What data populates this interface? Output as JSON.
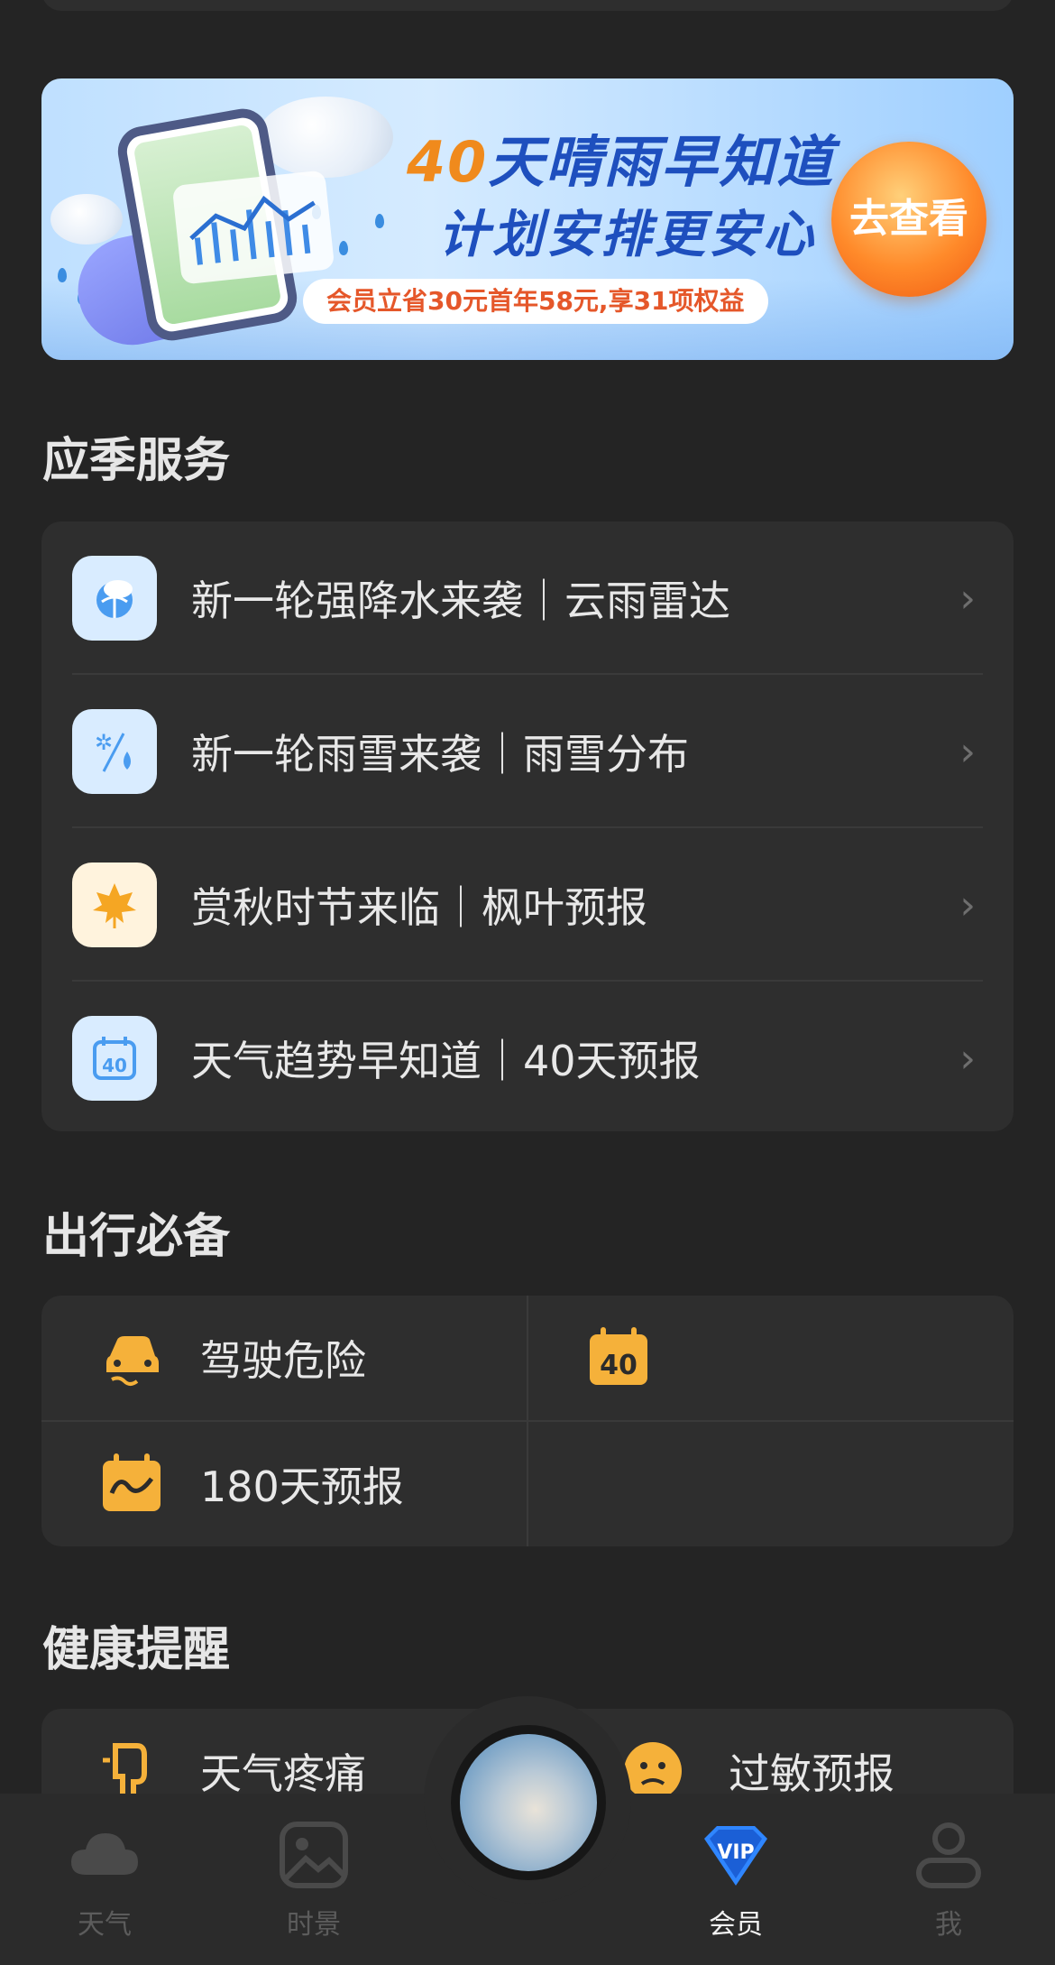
{
  "banner": {
    "headline_num": "40",
    "headline_text": "天晴雨早知道",
    "subline": "计划安排更安心",
    "promo": "会员立省30元首年58元,享31项权益",
    "cta": "去查看"
  },
  "seasonal": {
    "title": "应季服务",
    "items": [
      {
        "label": "新一轮强降水来袭｜云雨雷达",
        "icon": "cloud-rain-radar-icon"
      },
      {
        "label": "新一轮雨雪来袭｜雨雪分布",
        "icon": "rain-snow-icon"
      },
      {
        "label": "赏秋时节来临｜枫叶预报",
        "icon": "maple-leaf-icon"
      },
      {
        "label": "天气趋势早知道｜40天预报",
        "icon": "calendar-40-icon"
      }
    ]
  },
  "travel": {
    "title": "出行必备",
    "items": [
      {
        "label": "驾驶危险",
        "icon": "car-skid-icon"
      },
      {
        "label": "",
        "icon": "calendar-40-icon"
      },
      {
        "label": "180天预报",
        "icon": "calendar-wave-icon"
      }
    ],
    "calendar_number": "40"
  },
  "health": {
    "title": "健康提醒",
    "items": [
      {
        "label": "天气疼痛",
        "icon": "joint-pain-icon"
      },
      {
        "label": "过敏预报",
        "icon": "allergy-face-icon"
      }
    ]
  },
  "nav": {
    "items": [
      {
        "label": "天气",
        "icon": "cloud-icon",
        "active": false
      },
      {
        "label": "时景",
        "icon": "gallery-icon",
        "active": false
      },
      {
        "label": "会员",
        "icon": "vip-diamond-icon",
        "active": true
      },
      {
        "label": "我",
        "icon": "profile-icon",
        "active": false
      }
    ],
    "vip_badge": "VIP"
  },
  "colors": {
    "background": "#242424",
    "card": "#2e2e2e",
    "accent_orange": "#f5b13a",
    "accent_blue": "#1e4fbe",
    "vip_blue": "#2f86ff"
  }
}
